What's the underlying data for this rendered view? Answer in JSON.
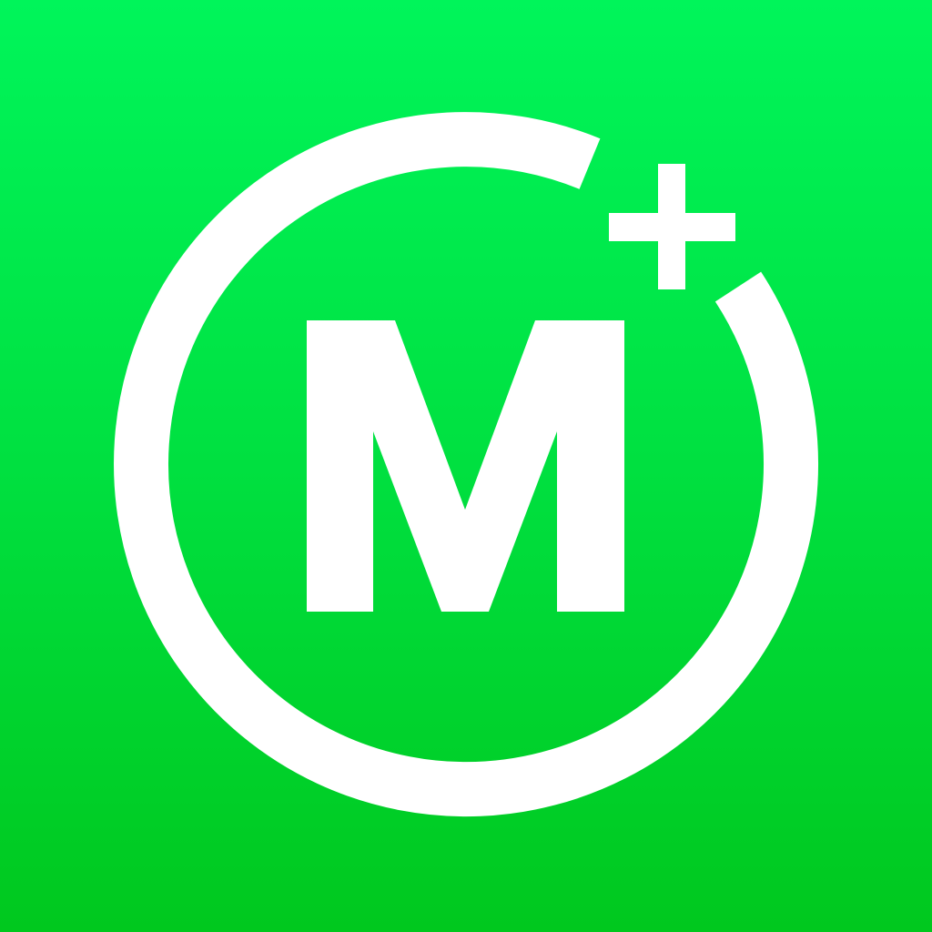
{
  "app_icon": {
    "logo_letter": "M",
    "plus_symbol": "+",
    "icon_name": "m-plus-logo-icon"
  },
  "colors": {
    "background_top": "#00F55A",
    "background_mid": "#00E040",
    "background_bottom": "#00C81E",
    "foreground": "#FFFFFF"
  }
}
